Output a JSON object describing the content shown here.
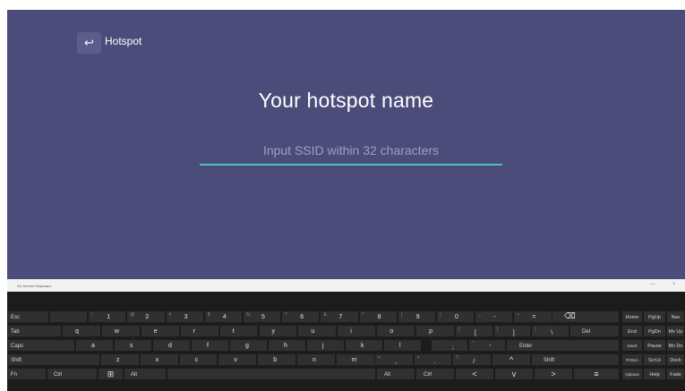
{
  "header": {
    "back_icon": "↩",
    "title": "Hotspot"
  },
  "main": {
    "title": "Your hotspot name",
    "ssid_placeholder": "Input SSID within 32 characters",
    "ssid_value": ""
  },
  "colors": {
    "background": "#4b4c7a",
    "input_underline": "#4bc3c6",
    "keyboard_bg": "#1c1c1c",
    "key_bg": "#303030"
  },
  "keyboard": {
    "title": "On-Screen Keyboard",
    "minimize": "—",
    "close": "×",
    "row1": [
      {
        "pri": "",
        "sec": ""
      },
      {
        "pri": "1",
        "sec": "!"
      },
      {
        "pri": "2",
        "sec": "@"
      },
      {
        "pri": "3",
        "sec": "#"
      },
      {
        "pri": "4",
        "sec": "$"
      },
      {
        "pri": "5",
        "sec": "%"
      },
      {
        "pri": "6",
        "sec": "^"
      },
      {
        "pri": "7",
        "sec": "&"
      },
      {
        "pri": "8",
        "sec": "*"
      },
      {
        "pri": "9",
        "sec": "("
      },
      {
        "pri": "0",
        "sec": ")"
      },
      {
        "pri": "-",
        "sec": "_"
      },
      {
        "pri": "=",
        "sec": "+"
      }
    ],
    "keys": {
      "esc": "Esc",
      "backspace_icon": "⌫",
      "tab": "Tab",
      "del": "Del",
      "caps": "Caps",
      "enter": "Enter",
      "shift_left": "Shift",
      "up_icon": "^",
      "shift_right": "Shift",
      "fn": "Fn",
      "ctrl_left": "Ctrl",
      "windows_icon": "⊞",
      "alt_left": "Alt",
      "alt_right": "Alt",
      "ctrl_right": "Ctrl",
      "left_icon": "<",
      "down_icon": "v",
      "right_icon": ">",
      "context_icon": "≡"
    },
    "row2": [
      "q",
      "w",
      "e",
      "r",
      "t",
      "y",
      "u",
      "i",
      "o",
      "p"
    ],
    "row2_brackets": [
      {
        "pri": "[",
        "sec": "{"
      },
      {
        "pri": "]",
        "sec": "}"
      },
      {
        "pri": "\\",
        "sec": "|"
      }
    ],
    "row3": [
      "a",
      "s",
      "d",
      "f",
      "g",
      "h",
      "j",
      "k",
      "l"
    ],
    "row3_punct": [
      {
        "pri": ";",
        "sec": ":"
      },
      {
        "pri": "'",
        "sec": "\""
      }
    ],
    "row4": [
      "z",
      "x",
      "c",
      "v",
      "b",
      "n",
      "m"
    ],
    "row4_punct": [
      {
        "pri": ",",
        "sec": "<"
      },
      {
        "pri": ".",
        "sec": ">"
      },
      {
        "pri": "/",
        "sec": "?"
      }
    ],
    "nav": [
      [
        "Home",
        "PgUp",
        "Nav"
      ],
      [
        "End",
        "PgDn",
        "Mv Up"
      ],
      [
        "Insert",
        "Pause",
        "Mv Dn"
      ],
      [
        "PrtScn",
        "ScrLk",
        "Dock"
      ],
      [
        "Options",
        "Help",
        "Fade"
      ]
    ]
  }
}
